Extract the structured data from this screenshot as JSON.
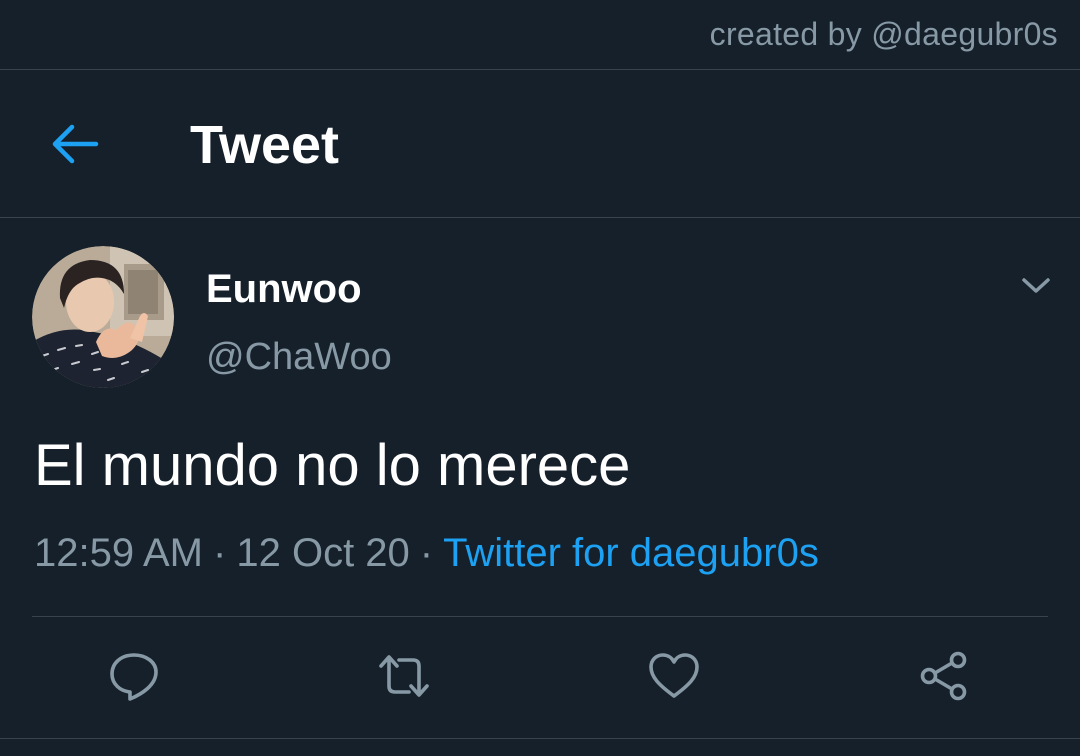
{
  "watermark": "created by @daegubr0s",
  "header": {
    "back_icon": "arrow-left-icon",
    "title": "Tweet"
  },
  "tweet": {
    "author": {
      "display_name": "Eunwoo",
      "handle": "@ChaWoo"
    },
    "menu_icon": "chevron-down-icon",
    "text": "El mundo no lo merece",
    "time": "12:59 AM",
    "separator": "·",
    "date": "12 Oct 20",
    "source": "Twitter for daegubr0s"
  },
  "actions": [
    {
      "icon": "reply-icon"
    },
    {
      "icon": "retweet-icon"
    },
    {
      "icon": "like-icon"
    },
    {
      "icon": "share-icon"
    }
  ],
  "colors": {
    "background": "#15202b",
    "divider": "#38444d",
    "accent": "#1da1f2",
    "secondary_text": "#8899a6",
    "primary_text": "#ffffff"
  }
}
